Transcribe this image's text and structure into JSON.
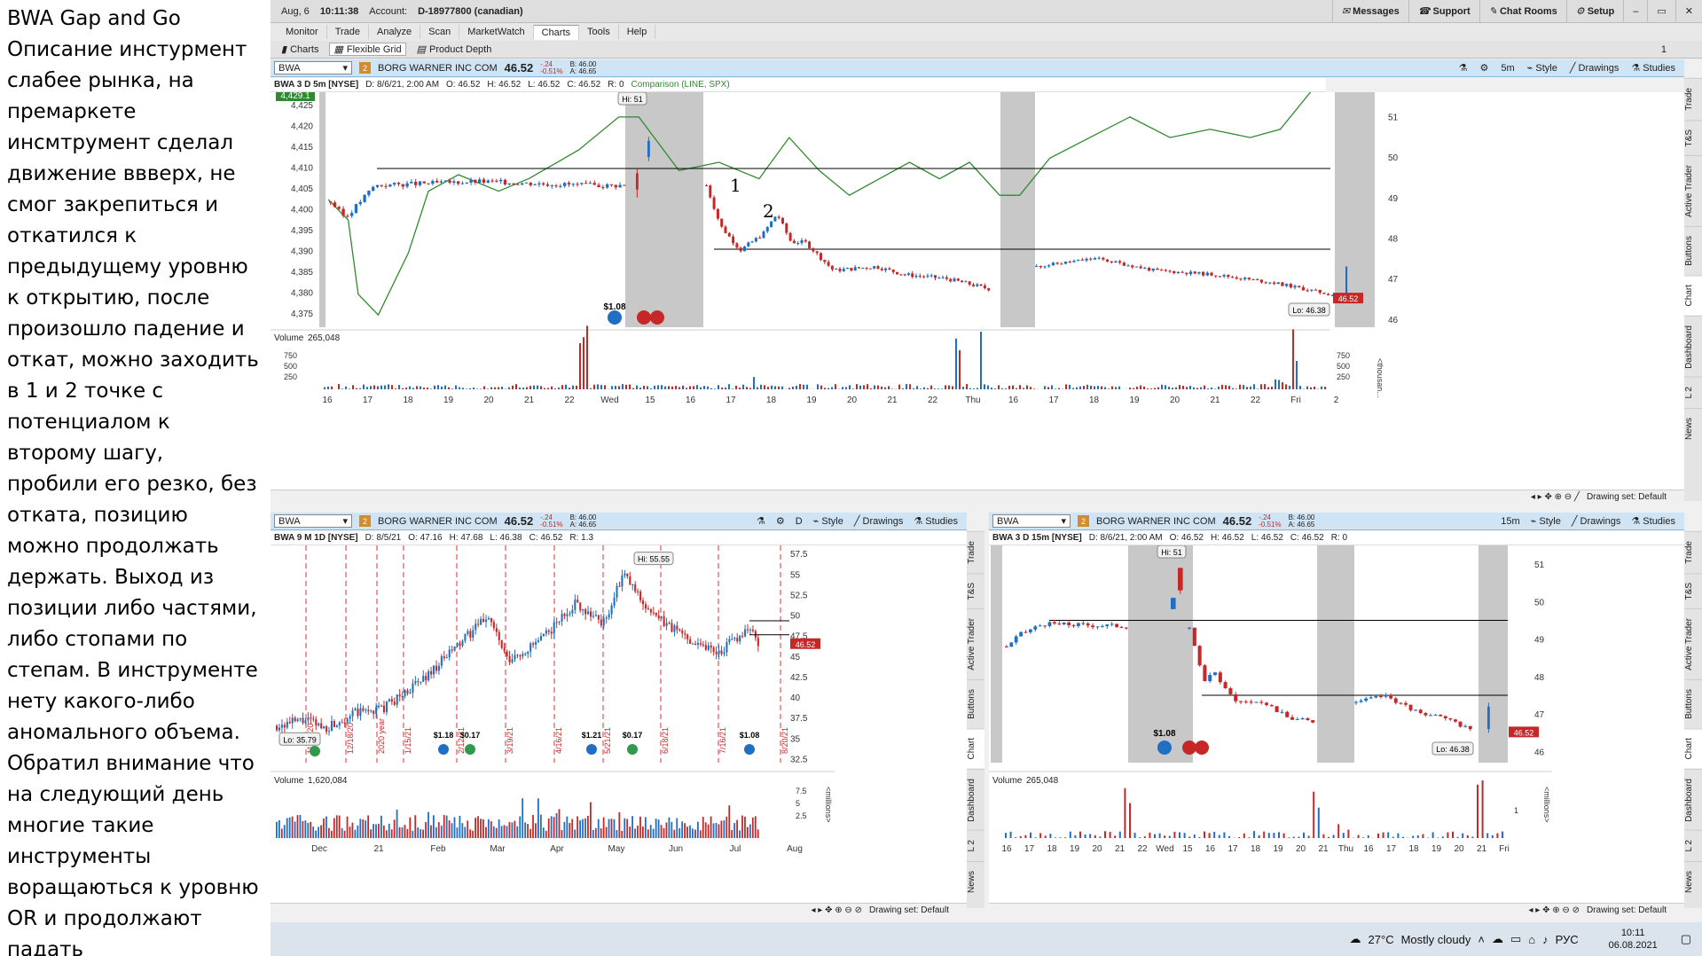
{
  "notes": {
    "text": "BWA Gap and Go\nОписание инстурмент слабее рынка, на премаркете инсмтрумент сделал движение ввверх, не смог закрепиться и откатился к предыдущему уровню к открытию, после произошло падение и откат, можно заходить в 1 и 2 точке с потенциалом к второму шагу, пробили его резко, без отката, позицию можно продолжать держать. Выход из позиции либо частями, либо стопами по степам. В инструменте нету какого-либо аномального объема. Обратил внимание что на следующий день многие такие инструменты воращаються к уровню OR и продолжают падать"
  },
  "status_bar": {
    "date": "Aug, 6",
    "time": "10:11:38",
    "account_label": "Account:",
    "account": "D-18977800 (canadian)",
    "messages": "Messages",
    "support": "Support",
    "chat_rooms": "Chat Rooms",
    "setup": "Setup"
  },
  "main_menu": [
    "Monitor",
    "Trade",
    "Analyze",
    "Scan",
    "MarketWatch",
    "Charts",
    "Tools",
    "Help"
  ],
  "sub_menu": {
    "charts": "Charts",
    "flexible_grid": "Flexible Grid",
    "product_depth": "Product Depth",
    "page": "1"
  },
  "quote": {
    "symbol": "BWA",
    "name": "BORG WARNER INC COM",
    "price": "46.52",
    "change": "-.24",
    "change_pct": "-0.51%",
    "bid": "B: 46.00",
    "ask": "A: 46.65",
    "badge": "2"
  },
  "toolbar": {
    "style": "Style",
    "drawings": "Drawings",
    "studies": "Studies"
  },
  "right_tabs": [
    "Trade",
    "T&S",
    "Active Trader",
    "Buttons",
    "Chart",
    "Dashboard",
    "L 2",
    "News"
  ],
  "drawing_set": "Drawing set: Default",
  "chart_top": {
    "interval": "5m",
    "header": {
      "title": "BWA 3 D 5m [NYSE]",
      "d": "D: 8/6/21, 2:00 AM",
      "o": "O: 46.52",
      "h": "H: 46.52",
      "l": "L: 46.52",
      "c": "C: 46.52",
      "r": "R: 0",
      "comparison": "Comparison (LINE, SPX)"
    },
    "left_axis": [
      "4,425",
      "4,420",
      "4,415",
      "4,410",
      "4,405",
      "4,400",
      "4,395",
      "4,390",
      "4,385",
      "4,380",
      "4,375"
    ],
    "left_badge": "4,429.1",
    "right_axis": [
      "51",
      "50",
      "49",
      "48",
      "47",
      "46"
    ],
    "price_badge": "46.52",
    "hi_label": "Hi: 51",
    "lo_label": "Lo: 46.38",
    "dividend": "$1.08",
    "point1": "1",
    "point2": "2",
    "volume_label": "Volume",
    "volume_value": "265,048",
    "vol_axis": [
      "750",
      "500",
      "250"
    ],
    "vol_unit": "<thousan...",
    "x_axis": [
      "16",
      "17",
      "18",
      "19",
      "20",
      "21",
      "22",
      "Wed",
      "15",
      "16",
      "17",
      "18",
      "19",
      "20",
      "21",
      "22",
      "Thu",
      "16",
      "17",
      "18",
      "19",
      "20",
      "21",
      "22",
      "Fri",
      "2"
    ]
  },
  "chart_bl": {
    "interval": "D",
    "header": {
      "title": "BWA 9 M 1D [NYSE]",
      "d": "D: 8/5/21",
      "o": "O: 47.16",
      "h": "H: 47.68",
      "l": "L: 46.38",
      "c": "C: 46.52",
      "r": "R: 1.3"
    },
    "right_axis": [
      "57.5",
      "55",
      "52.5",
      "50",
      "47.5",
      "45",
      "42.5",
      "40",
      "37.5",
      "35",
      "32.5"
    ],
    "price_badge": "46.52",
    "hi_label": "Hi: 55.55",
    "lo_label": "Lo: 35.79",
    "date_markers": [
      "11/20/20",
      "12/18/20",
      "2020 year",
      "1/15/21",
      "2/12/21",
      "3/19/21",
      "4/16/21",
      "5/21/21",
      "6/18/21",
      "7/16/21",
      "8/20/21"
    ],
    "dividends": [
      "$1.18",
      "$0.17",
      "$1.21",
      "$0.17",
      "$1.08"
    ],
    "volume_label": "Volume",
    "volume_value": "1,620,084",
    "vol_axis": [
      "7.5",
      "5",
      "2.5"
    ],
    "vol_unit": "<millions>",
    "x_axis": [
      "Dec",
      "21",
      "Feb",
      "Mar",
      "Apr",
      "May",
      "Jun",
      "Jul",
      "Aug"
    ]
  },
  "chart_br": {
    "interval": "15m",
    "header": {
      "title": "BWA 3 D 15m [NYSE]",
      "d": "D: 8/6/21, 2:00 AM",
      "o": "O: 46.52",
      "h": "H: 46.52",
      "l": "L: 46.52",
      "c": "C: 46.52",
      "r": "R: 0"
    },
    "right_axis": [
      "51",
      "50",
      "49",
      "48",
      "47",
      "46"
    ],
    "price_badge": "46.52",
    "hi_label": "Hi: 51",
    "lo_label": "Lo: 46.38",
    "dividend": "$1.08",
    "volume_label": "Volume",
    "volume_value": "265,048",
    "vol_axis": [
      "1"
    ],
    "vol_unit": "<millions>",
    "x_axis": [
      "16",
      "17",
      "18",
      "19",
      "20",
      "21",
      "22",
      "Wed",
      "15",
      "16",
      "17",
      "18",
      "19",
      "20",
      "21",
      "Thu",
      "16",
      "17",
      "18",
      "19",
      "20",
      "21",
      "Fri"
    ]
  },
  "taskbar": {
    "temp": "27°C",
    "weather": "Mostly cloudy",
    "lang": "РУС",
    "time": "10:11",
    "date": "06.08.2021"
  },
  "colors": {
    "up": "#1f6fc4",
    "down": "#c62828",
    "green": "#2f8a2f",
    "session": "#c8c8c8",
    "panel_bar": "#cfe4f4"
  }
}
